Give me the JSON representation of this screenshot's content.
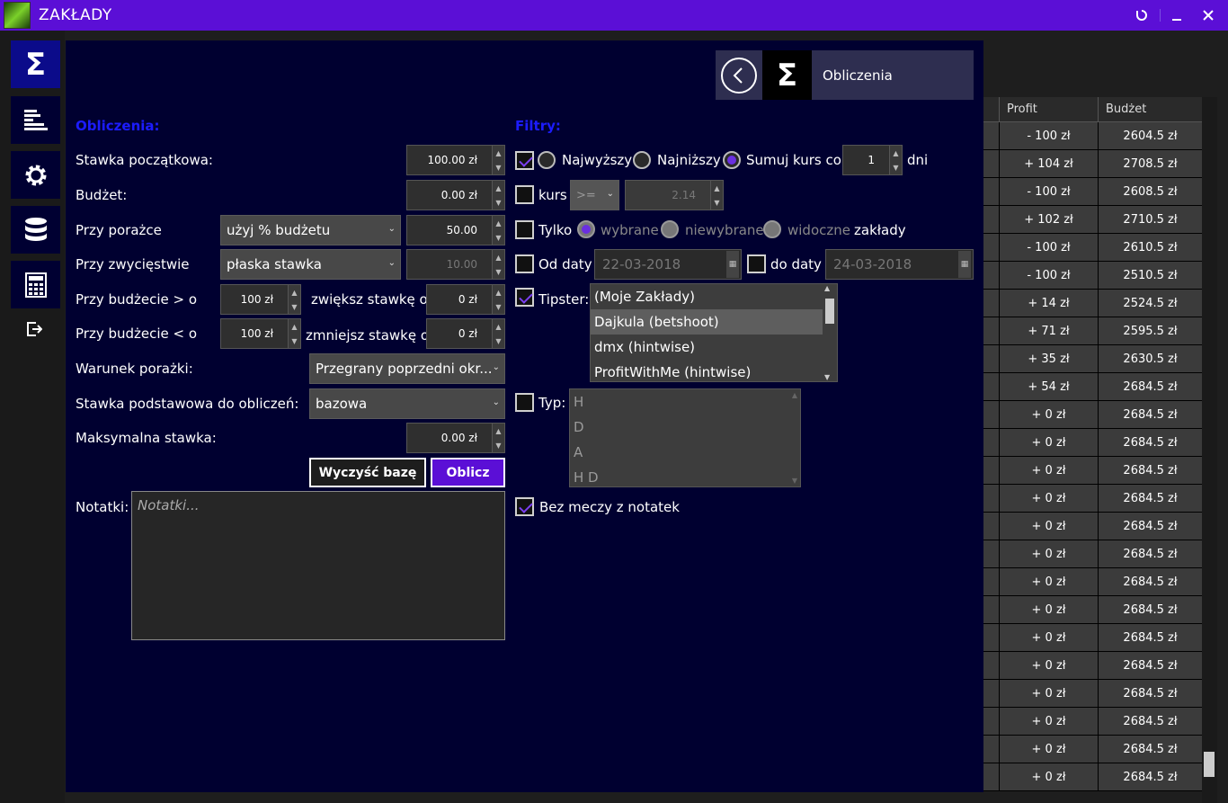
{
  "window": {
    "title": "ZAKŁADY"
  },
  "header": {
    "title": "Obliczenia"
  },
  "left": {
    "section_title": "Obliczenia:",
    "stawka_label": "Stawka początkowa:",
    "stawka_value": "100.00 zł",
    "budzet_label": "Budżet:",
    "budzet_value": "0.00 zł",
    "porazka_label": "Przy porażce",
    "porazka_select": "użyj % budżetu",
    "porazka_value": "50.00",
    "zwyciestwo_label": "Przy zwycięstwie",
    "zwyciestwo_select": "płaska stawka",
    "zwyciestwo_value": "10.00",
    "budzet_gt_label": "Przy budżecie > o",
    "budzet_gt_value": "100 zł",
    "zwieksz_label": "zwiększ stawkę o",
    "zwieksz_value": "0 zł",
    "budzet_lt_label": "Przy budżecie < o",
    "budzet_lt_value": "100 zł",
    "zmniejsz_label": "zmniejsz stawkę o",
    "zmniejsz_value": "0 zł",
    "warunek_label": "Warunek porażki:",
    "warunek_select": "Przegrany poprzedni okr...",
    "podstawowa_label": "Stawka podstawowa do obliczeń:",
    "podstawowa_select": "bazowa",
    "max_label": "Maksymalna stawka:",
    "max_value": "0.00 zł",
    "clear_button": "Wyczyść bazę",
    "calc_button": "Oblicz",
    "notes_label": "Notatki:",
    "notes_placeholder": "Notatki..."
  },
  "filters": {
    "section_title": "Filtry:",
    "najwyzszy": "Najwyższy",
    "najnizszy": "Najniższy",
    "sumuj": "Sumuj",
    "kurs_co": "kurs co",
    "days_value": "1",
    "dni": "dni",
    "kurs_label": "kurs",
    "kurs_op": ">=",
    "kurs_value": "2.14",
    "tylko": "Tylko",
    "wybrane": "wybrane",
    "niewybrane": "niewybrane",
    "widoczne": "widoczne",
    "zaklady": "zakłady",
    "od_daty": "Od daty",
    "od_value": "22-03-2018",
    "do_daty": "do daty",
    "do_value": "24-03-2018",
    "tipster_label": "Tipster:",
    "tipsters": [
      "(Moje Zakłady)",
      "Dajkula (betshoot)",
      "dmx (hintwise)",
      "ProfitWithMe (hintwise)"
    ],
    "typ_label": "Typ:",
    "types": [
      "H",
      "D",
      "A",
      "H D"
    ],
    "bez_meczy": "Bez meczy z notatek"
  },
  "grid": {
    "columns": [
      "Profit",
      "Budżet"
    ],
    "rows": [
      [
        "- 100 zł",
        "2604.5 zł"
      ],
      [
        "+ 104 zł",
        "2708.5 zł"
      ],
      [
        "- 100 zł",
        "2608.5 zł"
      ],
      [
        "+ 102 zł",
        "2710.5 zł"
      ],
      [
        "- 100 zł",
        "2610.5 zł"
      ],
      [
        "- 100 zł",
        "2510.5 zł"
      ],
      [
        "+ 14 zł",
        "2524.5 zł"
      ],
      [
        "+ 71 zł",
        "2595.5 zł"
      ],
      [
        "+ 35 zł",
        "2630.5 zł"
      ],
      [
        "+ 54 zł",
        "2684.5 zł"
      ],
      [
        "+ 0 zł",
        "2684.5 zł"
      ],
      [
        "+ 0 zł",
        "2684.5 zł"
      ],
      [
        "+ 0 zł",
        "2684.5 zł"
      ],
      [
        "+ 0 zł",
        "2684.5 zł"
      ],
      [
        "+ 0 zł",
        "2684.5 zł"
      ],
      [
        "+ 0 zł",
        "2684.5 zł"
      ],
      [
        "+ 0 zł",
        "2684.5 zł"
      ],
      [
        "+ 0 zł",
        "2684.5 zł"
      ],
      [
        "+ 0 zł",
        "2684.5 zł"
      ],
      [
        "+ 0 zł",
        "2684.5 zł"
      ],
      [
        "+ 0 zł",
        "2684.5 zł"
      ],
      [
        "+ 0 zł",
        "2684.5 zł"
      ],
      [
        "+ 0 zł",
        "2684.5 zł"
      ],
      [
        "+ 0 zł",
        "2684.5 zł"
      ]
    ]
  },
  "colors": {
    "accent": "#5b0fd6",
    "panel": "#000030",
    "section": "#1c1cff"
  }
}
